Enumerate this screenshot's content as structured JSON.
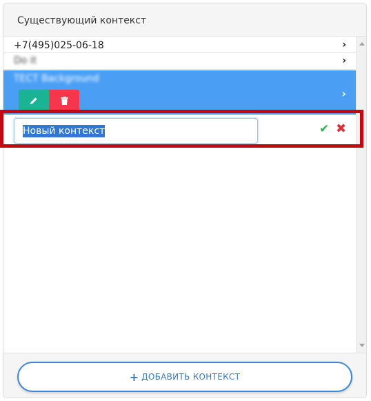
{
  "panel": {
    "title": "Существующий контекст"
  },
  "list": {
    "items": [
      {
        "label": "+7(495)025-06-18",
        "chevron": "›"
      },
      {
        "label": "Do it",
        "chevron": "›"
      },
      {
        "label": "ТЕСТ Background",
        "chevron": "›",
        "selected": true
      }
    ],
    "edit_icon": "pencil-icon",
    "delete_icon": "trash-icon"
  },
  "new_item": {
    "value": "Новый контекст",
    "confirm_symbol": "✔",
    "cancel_symbol": "✖"
  },
  "footer": {
    "add_plus": "+",
    "add_label": "ДОБАВИТЬ КОНТЕКСТ"
  },
  "colors": {
    "accent": "#4a9ff5",
    "edit": "#1ab394",
    "delete": "#f5364d",
    "highlight": "#c40811"
  }
}
